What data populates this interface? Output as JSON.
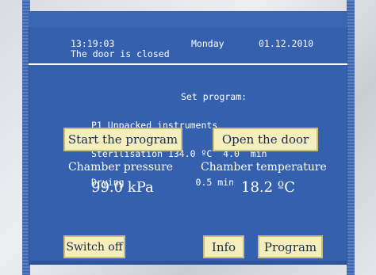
{
  "header": {
    "time": "13:19:03",
    "day": "Monday",
    "date": "01.12.2010",
    "door_status": "The door is closed"
  },
  "program": {
    "title": "Set program:",
    "name": "P1 Unpacked instruments",
    "sterilisation_line": "Sterilisation 134.0 ºC  4.0  min",
    "drying_line": "Drying             0.5 min"
  },
  "buttons": {
    "start": "Start the program",
    "open_door": "Open the door",
    "switch_off": "Switch off",
    "info": "Info",
    "program": "Program"
  },
  "readings": {
    "pressure_label": "Chamber pressure",
    "pressure_value": "99.0 kPa",
    "temperature_label": "Chamber temperature",
    "temperature_value": "18.2 ºC"
  }
}
